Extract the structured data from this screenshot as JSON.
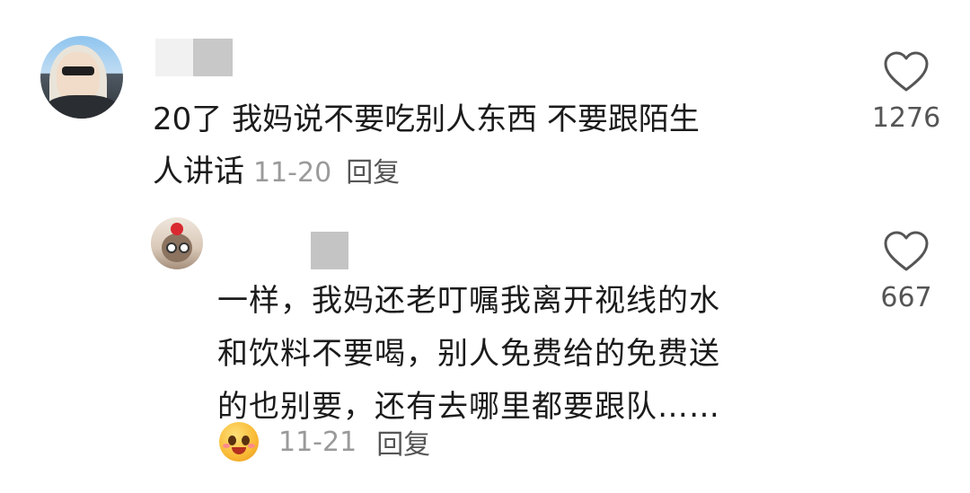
{
  "comment": {
    "text_line1": "20了 我妈说不要吃别人东西 不要跟陌生",
    "text_line2": "人讲话",
    "date": "11-20",
    "reply_label": "回复",
    "likes": "1276"
  },
  "reply": {
    "text_line1": "一样，我妈还老叮嘱我离开视线的水",
    "text_line2": "和饮料不要喝，别人免费给的免费送",
    "text_line3": "的也别要，还有去哪里都要跟队……",
    "date": "11-21",
    "reply_label": "回复",
    "likes": "667"
  },
  "icons": {
    "like": "heart-outline-icon",
    "emoji": "smiling-face-emoji-icon"
  },
  "colors": {
    "text": "#1b1b1b",
    "meta": "#9a9a9a",
    "icon": "#555555"
  }
}
